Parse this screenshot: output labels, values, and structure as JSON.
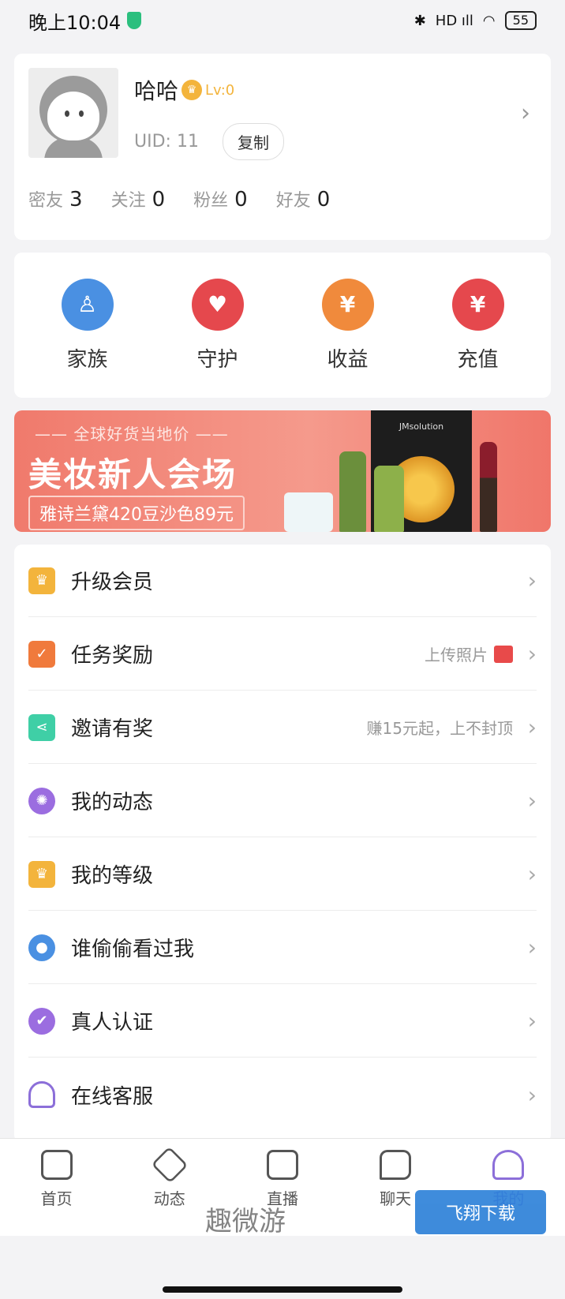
{
  "status_bar": {
    "time": "晚上10:04",
    "network": "HD ıll",
    "battery": "55"
  },
  "profile": {
    "username": "哈哈",
    "level": "Lv:0",
    "uid_label": "UID:",
    "uid_value": "11",
    "copy_label": "复制",
    "stats": [
      {
        "label": "密友",
        "value": "3"
      },
      {
        "label": "关注",
        "value": "0"
      },
      {
        "label": "粉丝",
        "value": "0"
      },
      {
        "label": "好友",
        "value": "0"
      }
    ]
  },
  "quick_menu": [
    {
      "label": "家族",
      "icon": "family-icon",
      "color": "#4a90e2"
    },
    {
      "label": "守护",
      "icon": "heart-pulse-icon",
      "color": "#e5484d"
    },
    {
      "label": "收益",
      "icon": "money-bag-icon",
      "color": "#f08a3c"
    },
    {
      "label": "充值",
      "icon": "recharge-icon",
      "color": "#e5484d"
    }
  ],
  "banner": {
    "subtitle": "全球好货当地价",
    "title": "美妆新人会场",
    "promo": "雅诗兰黛420豆沙色89元",
    "product_text": "JMsolution"
  },
  "menu": [
    {
      "label": "升级会员",
      "extra": "",
      "icon": "crown-icon",
      "color": "#f3b43c"
    },
    {
      "label": "任务奖励",
      "extra": "上传照片",
      "icon": "task-calendar-icon",
      "color": "#f07a3c"
    },
    {
      "label": "邀请有奖",
      "extra": "赚15元起，上不封顶",
      "icon": "share-icon",
      "color": "#3fcfa6"
    },
    {
      "label": "我的动态",
      "extra": "",
      "icon": "aperture-icon",
      "color": "#9b6de0"
    },
    {
      "label": "我的等级",
      "extra": "",
      "icon": "crown-icon",
      "color": "#f3b43c"
    },
    {
      "label": "谁偷偷看过我",
      "extra": "",
      "icon": "footprint-icon",
      "color": "#4a90e2"
    },
    {
      "label": "真人认证",
      "extra": "",
      "icon": "verified-user-icon",
      "color": "#9b6de0"
    },
    {
      "label": "在线客服",
      "extra": "",
      "icon": "headset-icon",
      "color": "#8c6fd9"
    }
  ],
  "tabbar": [
    {
      "label": "首页",
      "icon": "home-icon"
    },
    {
      "label": "动态",
      "icon": "cube-icon"
    },
    {
      "label": "直播",
      "icon": "live-tv-icon"
    },
    {
      "label": "聊天",
      "icon": "chat-icon"
    },
    {
      "label": "我的",
      "icon": "user-icon",
      "active": true
    }
  ],
  "watermarks": {
    "left": "趣微游",
    "right": "飞翔下载"
  }
}
